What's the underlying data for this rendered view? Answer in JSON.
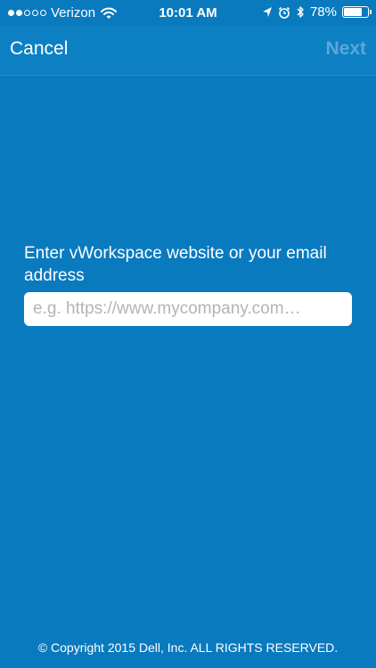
{
  "status_bar": {
    "carrier": "Verizon",
    "signal_bars_filled": 2,
    "signal_bars_total": 5,
    "time": "10:01 AM",
    "battery_percent": "78%",
    "battery_level": 0.78
  },
  "nav": {
    "cancel_label": "Cancel",
    "next_label": "Next"
  },
  "form": {
    "label": "Enter vWorkspace website or your email address",
    "input_value": "",
    "input_placeholder": "e.g. https://www.mycompany.com…"
  },
  "footer": {
    "copyright": "© Copyright 2015 Dell, Inc. ALL RIGHTS RESERVED."
  },
  "colors": {
    "background": "#0a7abf",
    "nav_background": "#0d80c4",
    "next_disabled": "#5aa8d8"
  },
  "icons": [
    "wifi-icon",
    "location-arrow-icon",
    "alarm-clock-icon",
    "bluetooth-icon",
    "battery-icon"
  ]
}
